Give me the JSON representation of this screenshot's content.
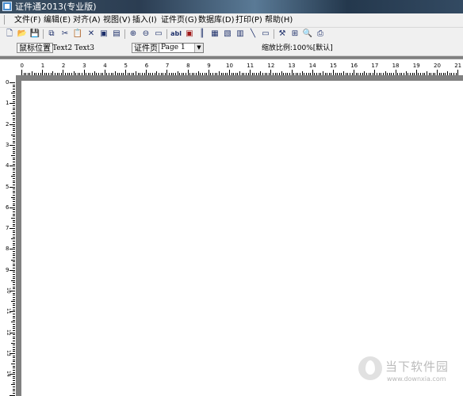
{
  "window": {
    "title": "证件通2013(专业版)"
  },
  "menu": [
    "文件(F)",
    "编辑(E)",
    "对齐(A)",
    "视图(V)",
    "插入(I)",
    "证件页(G)",
    "数据库(D)",
    "打印(P)",
    "帮助(H)"
  ],
  "toolbar": {
    "buttons": [
      {
        "name": "new-icon",
        "glyph": "🗋"
      },
      {
        "name": "open-icon",
        "glyph": "📂"
      },
      {
        "name": "save-icon",
        "glyph": "💾"
      },
      {
        "name": "copy-icon",
        "glyph": "⧉"
      },
      {
        "name": "cut-icon",
        "glyph": "✂"
      },
      {
        "name": "paste-icon",
        "glyph": "📋"
      },
      {
        "name": "delete-icon",
        "glyph": "✕"
      },
      {
        "name": "pdf-icon",
        "glyph": "▣"
      },
      {
        "name": "properties-icon",
        "glyph": "▤"
      },
      {
        "name": "zoom-in-icon",
        "glyph": "⊕"
      },
      {
        "name": "zoom-out-icon",
        "glyph": "⊖"
      },
      {
        "name": "fit-icon",
        "glyph": "▭"
      },
      {
        "name": "text-icon",
        "glyph": "abl"
      },
      {
        "name": "photo-icon",
        "glyph": "▣"
      },
      {
        "name": "barcode-icon",
        "glyph": "║"
      },
      {
        "name": "field-icon",
        "glyph": "▦"
      },
      {
        "name": "image-icon",
        "glyph": "▧"
      },
      {
        "name": "database-icon",
        "glyph": "▥"
      },
      {
        "name": "line-icon",
        "glyph": "╲"
      },
      {
        "name": "rectangle-icon",
        "glyph": "▭"
      },
      {
        "name": "tools-icon",
        "glyph": "⚒"
      },
      {
        "name": "grid-icon",
        "glyph": "⊞"
      },
      {
        "name": "print-preview-icon",
        "glyph": "🔍"
      },
      {
        "name": "print-icon",
        "glyph": "⎙"
      }
    ]
  },
  "infobar": {
    "mouse_position_label": "鼠标位置",
    "text_items": "Text2  Text3",
    "page_label": "证件页",
    "page_select_value": "Page 1",
    "zoom_label": "缩放比例:100%[默认]"
  },
  "rulers": {
    "horizontal_labels": [
      "0",
      "1",
      "2",
      "3",
      "4",
      "5",
      "6",
      "7",
      "8",
      "9",
      "10",
      "11",
      "12",
      "13",
      "14",
      "15",
      "16",
      "17",
      "18",
      "19",
      "20",
      "21"
    ],
    "vertical_labels": [
      "0",
      "1",
      "2",
      "3",
      "4",
      "5",
      "6",
      "7",
      "8",
      "9",
      "10",
      "11",
      "12",
      "13",
      "14"
    ]
  },
  "watermark": {
    "brand": "当下软件园",
    "url": "www.downxia.com"
  }
}
